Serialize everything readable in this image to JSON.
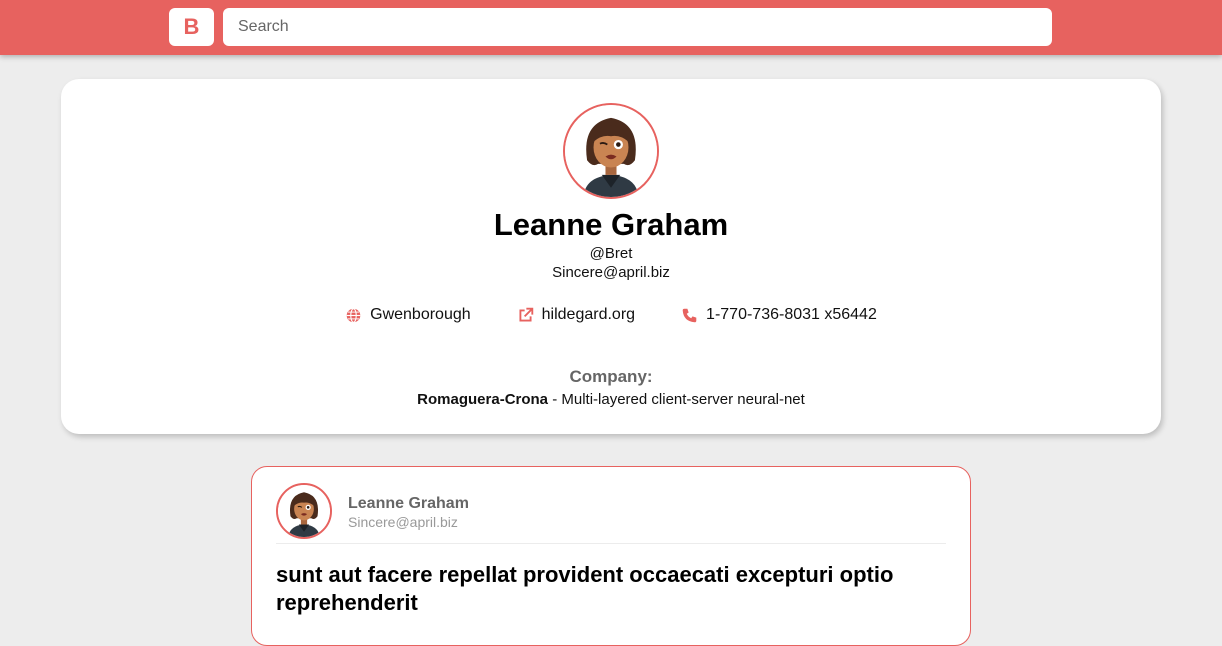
{
  "header": {
    "logo_text": "B",
    "search_placeholder": "Search",
    "search_value": ""
  },
  "profile": {
    "name": "Leanne Graham",
    "username": "@Bret",
    "email": "Sincere@april.biz",
    "city": "Gwenborough",
    "website": "hildegard.org",
    "phone": "1-770-736-8031 x56442",
    "company_label": "Company:",
    "company_name": "Romaguera-Crona",
    "company_separator": " - ",
    "company_catchphrase": "Multi-layered client-server neural-net"
  },
  "post": {
    "author_name": "Leanne Graham",
    "author_email": "Sincere@april.biz",
    "title": "sunt aut facere repellat provident occaecati excepturi optio reprehenderit"
  },
  "icons": {
    "city": "globe-icon",
    "website": "external-link-icon",
    "phone": "phone-icon"
  },
  "colors": {
    "accent": "#e7625f",
    "background": "#ededed",
    "card": "#ffffff"
  }
}
